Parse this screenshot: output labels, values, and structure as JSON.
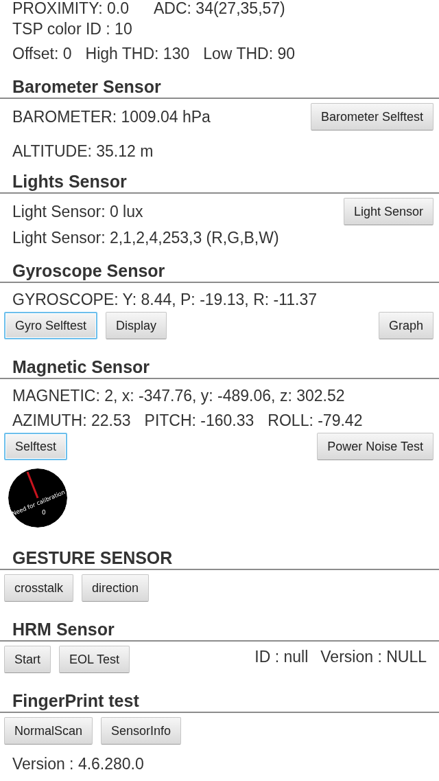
{
  "top_rows": [
    {
      "texts": [
        "PROXIMITY: 0.0",
        "ADC: 34(27,35,57)"
      ]
    },
    {
      "texts": [
        "TSP color ID : 10"
      ]
    },
    {
      "texts": [
        "Offset: 0",
        "High THD: 130",
        "Low THD: 90"
      ]
    }
  ],
  "sections": [
    {
      "title": "Barometer Sensor",
      "rows": [
        {
          "kind": "info",
          "texts": [
            "BAROMETER: 1009.04 hPa"
          ],
          "button": {
            "label": "Barometer Selftest",
            "focused": false
          }
        },
        {
          "kind": "info",
          "texts": [
            "ALTITUDE: 35.12 m"
          ]
        }
      ]
    },
    {
      "title": "Lights Sensor",
      "rows": [
        {
          "kind": "info",
          "texts": [
            "Light Sensor: 0 lux"
          ],
          "button": {
            "label": "Light Sensor",
            "focused": false
          }
        },
        {
          "kind": "info",
          "texts": [
            "Light Sensor: 2,1,2,4,253,3 (R,G,B,W)"
          ]
        }
      ]
    },
    {
      "title": "Gyroscope Sensor",
      "rows": [
        {
          "kind": "info",
          "texts": [
            "GYROSCOPE: Y: 8.44, P: -19.13, R: -11.37"
          ]
        },
        {
          "kind": "buttons",
          "buttons": [
            {
              "label": "Gyro Selftest",
              "focused": true
            },
            {
              "label": "Display",
              "focused": false
            }
          ],
          "right_buttons": [
            {
              "label": "Graph",
              "focused": false
            }
          ]
        }
      ]
    },
    {
      "title": "Magnetic Sensor",
      "rows": [
        {
          "kind": "info",
          "texts": [
            "MAGNETIC: 2, x: -347.76, y: -489.06, z: 302.52"
          ]
        },
        {
          "kind": "info",
          "texts": [
            "AZIMUTH: 22.53",
            "PITCH: -160.33",
            "ROLL: -79.42"
          ]
        },
        {
          "kind": "buttons",
          "buttons": [
            {
              "label": "Selftest",
              "focused": true
            }
          ],
          "right_buttons": [
            {
              "label": "Power Noise Test",
              "focused": false
            }
          ]
        },
        {
          "kind": "compass",
          "label": "Need for calibration",
          "reading": "0"
        }
      ]
    },
    {
      "title": "GESTURE SENSOR",
      "rows": [
        {
          "kind": "buttons",
          "buttons": [
            {
              "label": "crosstalk",
              "focused": false
            },
            {
              "label": "direction",
              "focused": false
            }
          ]
        }
      ]
    },
    {
      "title": "HRM Sensor",
      "rows": [
        {
          "kind": "buttons",
          "buttons": [
            {
              "label": "Start",
              "focused": false
            },
            {
              "label": "EOL Test",
              "focused": false
            }
          ],
          "right_texts": [
            "ID : null",
            "Version : NULL"
          ]
        }
      ]
    },
    {
      "title": "FingerPrint test",
      "rows": [
        {
          "kind": "buttons",
          "buttons": [
            {
              "label": "NormalScan",
              "focused": false
            },
            {
              "label": "SensorInfo",
              "focused": false
            }
          ]
        },
        {
          "kind": "info",
          "texts": [
            "Version : 4.6.280.0"
          ]
        }
      ]
    }
  ]
}
